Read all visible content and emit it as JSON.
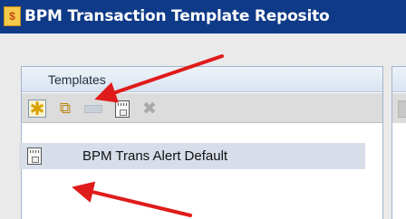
{
  "window": {
    "title": "BPM Transaction Template Reposito",
    "app_icon": "app-logo-icon"
  },
  "panel": {
    "title": "Templates",
    "toolbar": [
      {
        "name": "new-icon",
        "tooltip": "New"
      },
      {
        "name": "copy-icon",
        "tooltip": "Copy"
      },
      {
        "name": "rename-icon",
        "tooltip": "Rename"
      },
      {
        "name": "template-icon",
        "tooltip": "Template"
      },
      {
        "name": "delete-icon",
        "tooltip": "Delete"
      }
    ]
  },
  "list": {
    "items": [
      {
        "label": "BPM Trans Alert Default",
        "icon": "template-doc-icon",
        "selected": true
      }
    ]
  },
  "colors": {
    "titlebar": "#0f3a88",
    "header": "#d9e4f1",
    "selected_row": "#d7deea",
    "annotation_arrow": "#e01b1b"
  }
}
